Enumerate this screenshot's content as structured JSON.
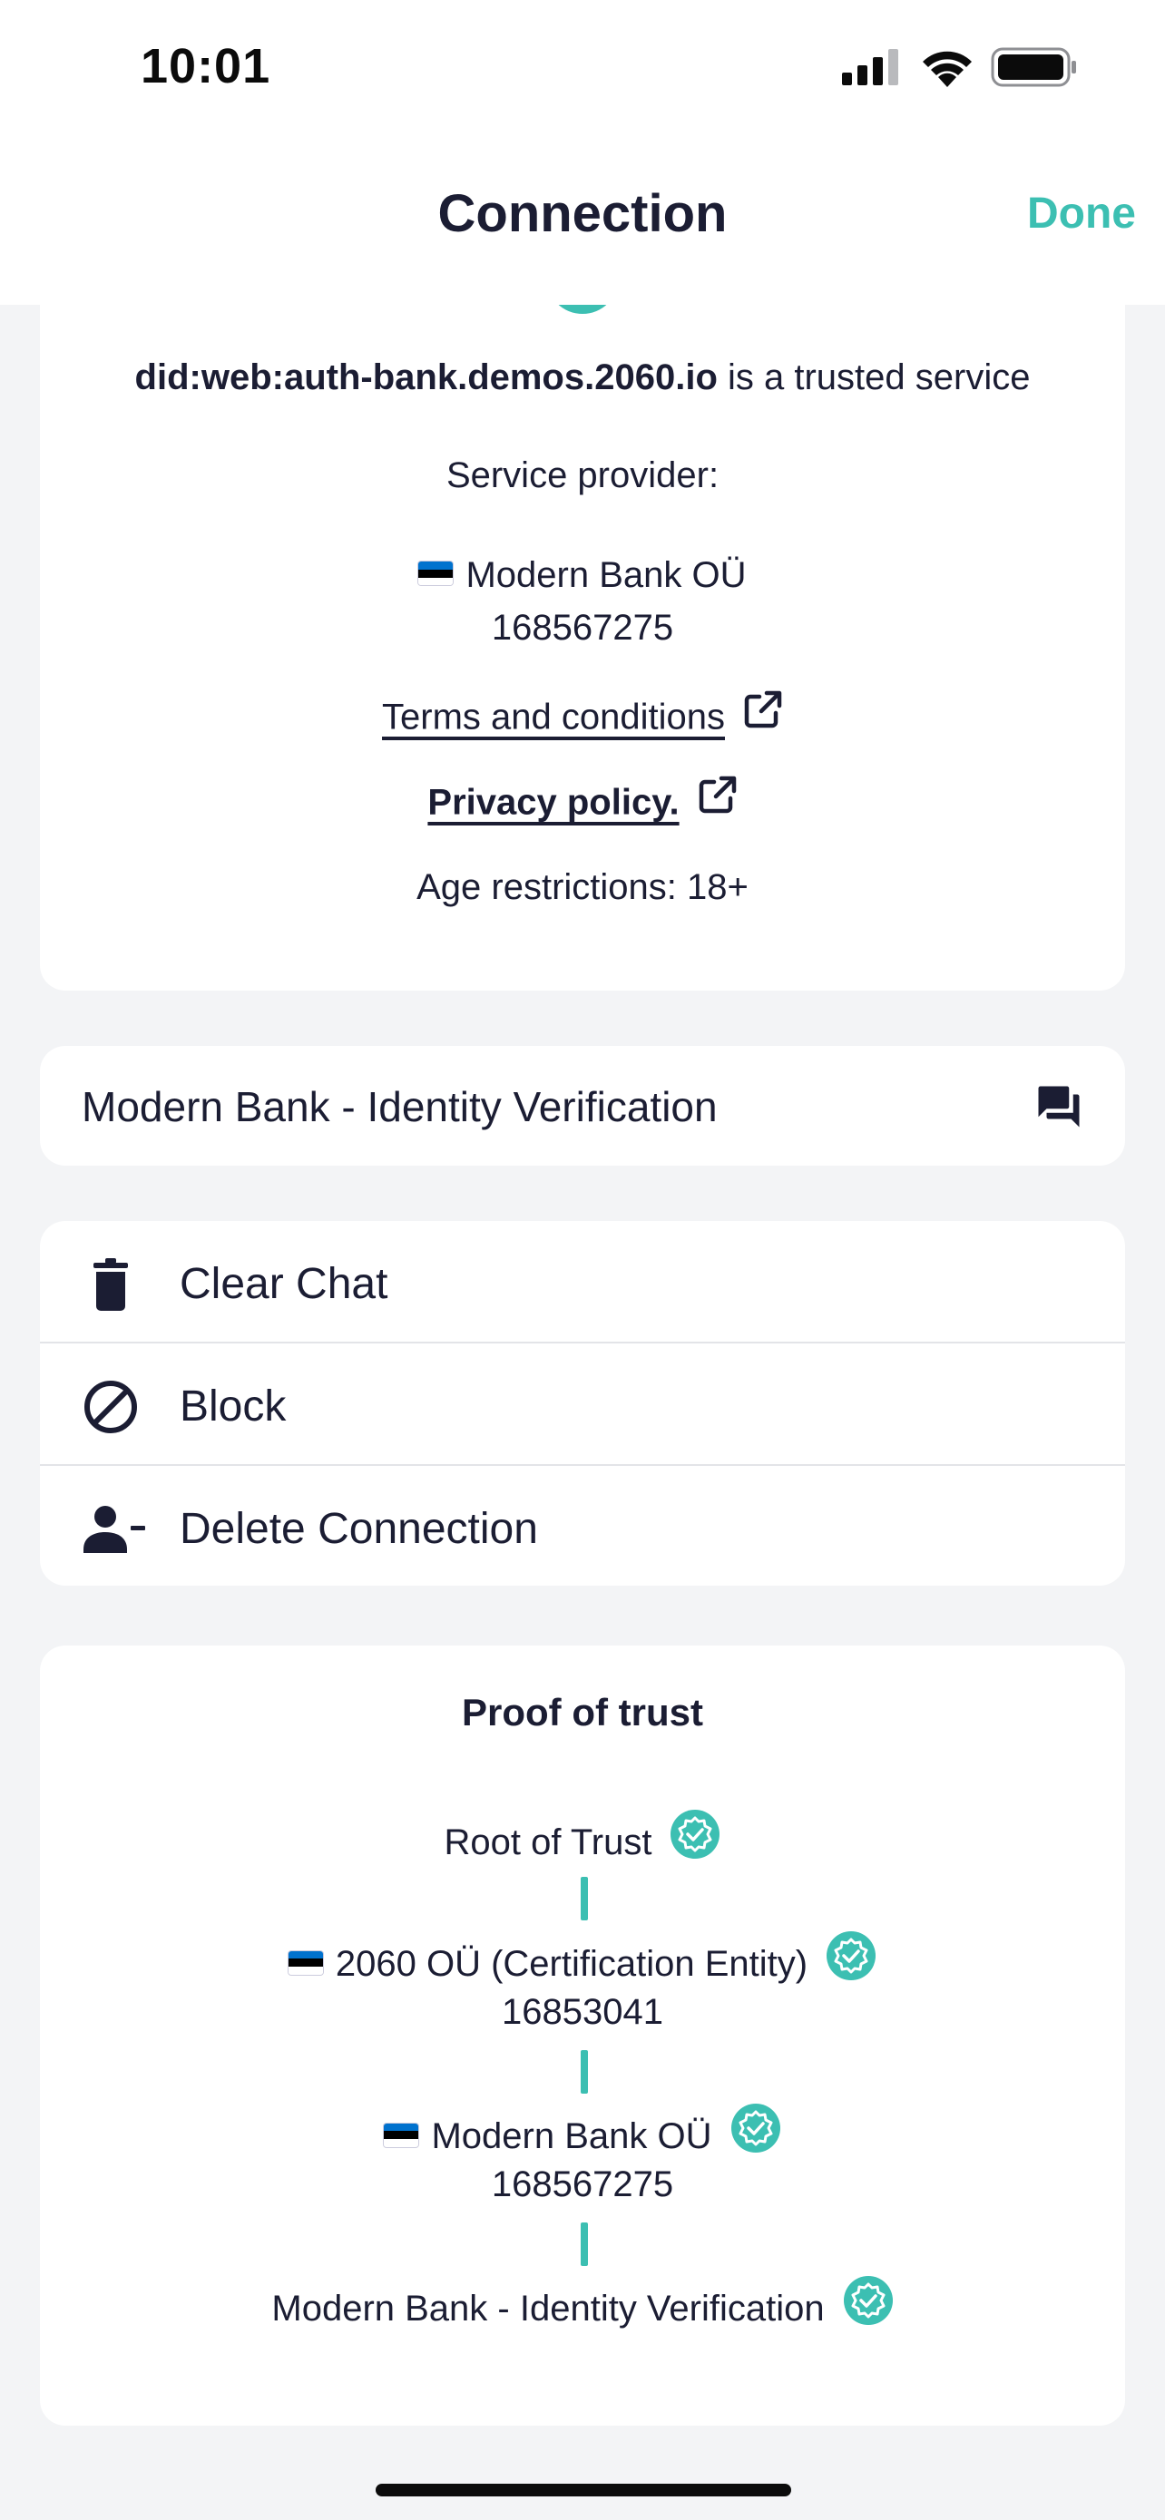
{
  "status_bar": {
    "time": "10:01"
  },
  "nav": {
    "title": "Connection",
    "done_label": "Done"
  },
  "service": {
    "did": "did:web:auth-bank.demos.2060.io",
    "trusted_suffix": " is a trusted service",
    "provider_heading": "Service provider:",
    "provider_name": "Modern Bank OÜ",
    "provider_id": "168567275",
    "terms_label": "Terms and conditions",
    "privacy_label": "Privacy policy.",
    "age_restrictions": "Age restrictions: 18+"
  },
  "chat": {
    "name": "Modern Bank - Identity Verification"
  },
  "actions": [
    {
      "label": "Clear Chat",
      "icon": "trash-icon"
    },
    {
      "label": "Block",
      "icon": "block-icon"
    },
    {
      "label": "Delete Connection",
      "icon": "person-remove-icon"
    }
  ],
  "trust": {
    "title": "Proof of trust",
    "chain": [
      {
        "name": "Root of Trust",
        "id": ""
      },
      {
        "name": "2060 OÜ (Certification Entity)",
        "id": "16853041"
      },
      {
        "name": "Modern Bank OÜ",
        "id": "168567275"
      },
      {
        "name": "Modern Bank - Identity Verification",
        "id": ""
      }
    ]
  },
  "colors": {
    "accent": "#3cbfb2",
    "text": "#1b1d33",
    "background": "#f3f4f6"
  }
}
